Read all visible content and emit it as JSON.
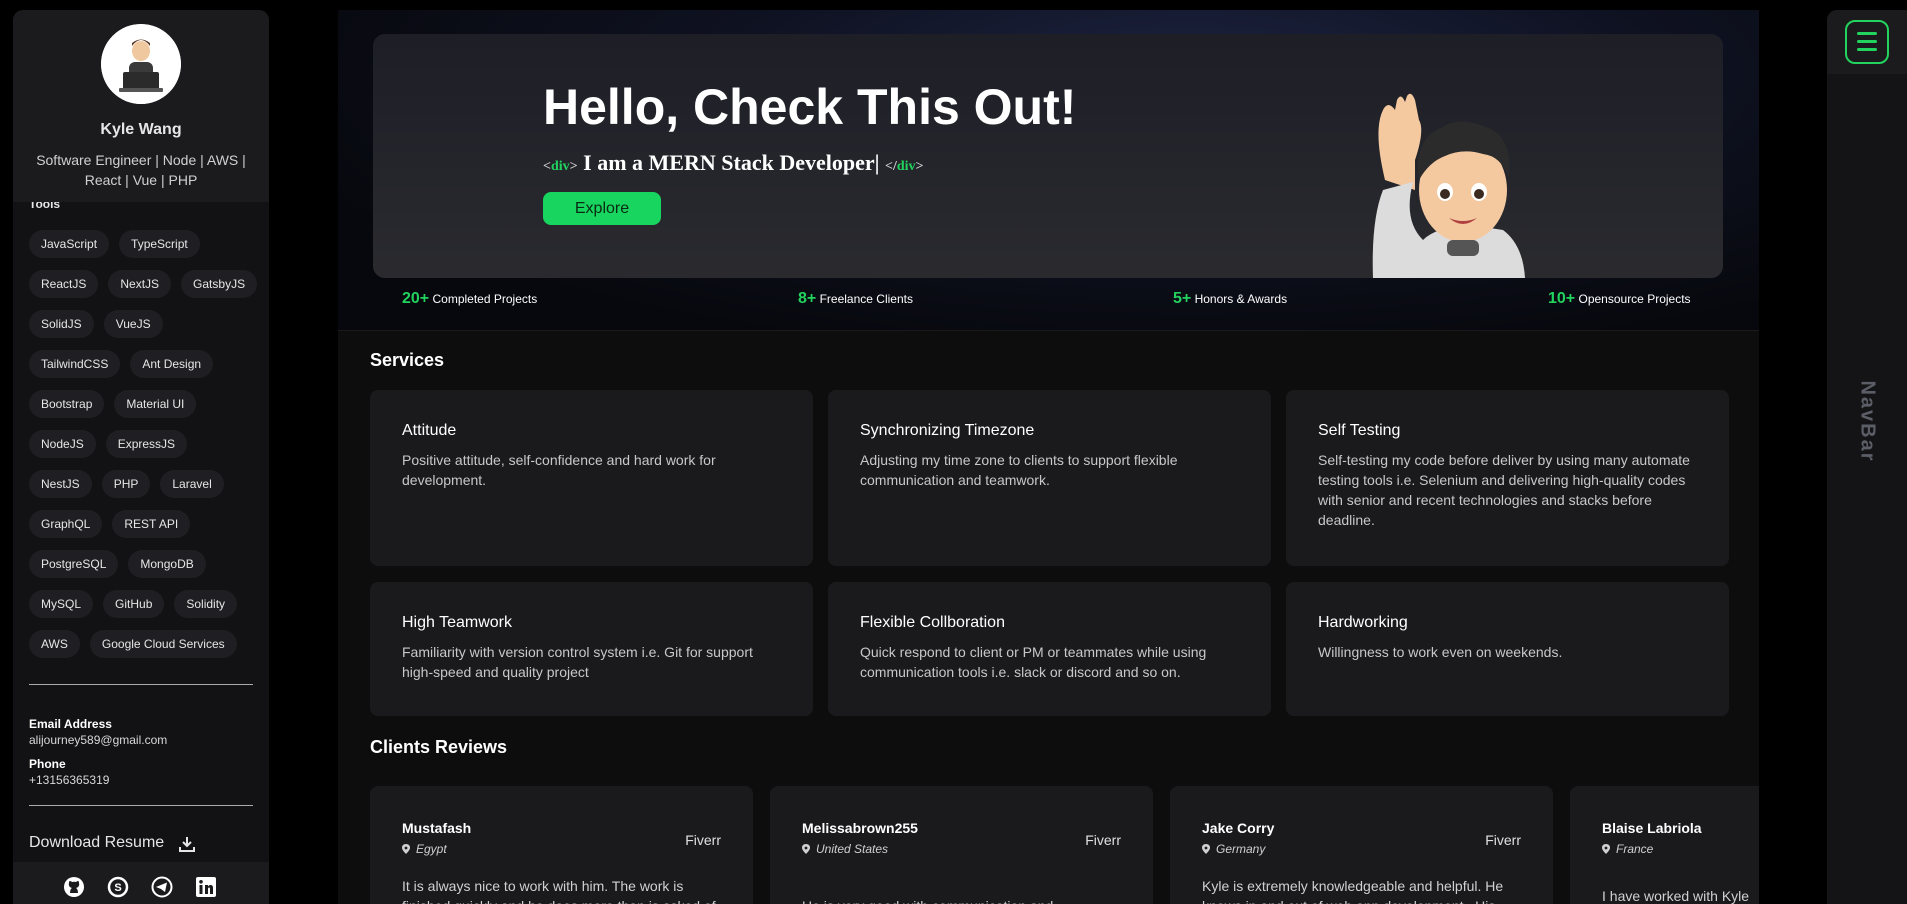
{
  "profile": {
    "name": "Kyle Wang",
    "title": "Software Engineer | Node | AWS | React | Vue | PHP"
  },
  "tools": {
    "label": "Tools",
    "items": [
      "JavaScript",
      "TypeScript",
      "ReactJS",
      "NextJS",
      "GatsbyJS",
      "SolidJS",
      "VueJS",
      "TailwindCSS",
      "Ant Design",
      "Bootstrap",
      "Material UI",
      "NodeJS",
      "ExpressJS",
      "NestJS",
      "PHP",
      "Laravel",
      "GraphQL",
      "REST API",
      "PostgreSQL",
      "MongoDB",
      "MySQL",
      "GitHub",
      "Solidity",
      "AWS",
      "Google Cloud Services"
    ]
  },
  "contact": {
    "email_label": "Email Address",
    "email": "alijourney589@gmail.com",
    "phone_label": "Phone",
    "phone": "+13156365319"
  },
  "resume": {
    "label": "Download Resume",
    "icon": "download-icon"
  },
  "social": [
    "github-icon",
    "skype-icon",
    "telegram-icon",
    "linkedin-icon"
  ],
  "hero": {
    "title": "Hello, Check This Out!",
    "open_tag": "<div>",
    "subtitle": "I am a MERN Stack Developer|",
    "close_tag": "</div>",
    "button": "Explore"
  },
  "stats": [
    {
      "value": "20+",
      "label": "Completed Projects"
    },
    {
      "value": "8+",
      "label": "Freelance Clients"
    },
    {
      "value": "5+",
      "label": "Honors & Awards"
    },
    {
      "value": "10+",
      "label": "Opensource Projects"
    }
  ],
  "services": {
    "title": "Services",
    "items": [
      {
        "title": "Attitude",
        "text": "Positive attitude, self-confidence and hard work for development."
      },
      {
        "title": "Synchronizing Timezone",
        "text": "Adjusting my time zone to clients to support flexible communication and teamwork."
      },
      {
        "title": "Self Testing",
        "text": "Self-testing my code before deliver by using many automate testing tools i.e. Selenium and delivering high-quality codes with senior and recent technologies and stacks before deadline."
      },
      {
        "title": "High Teamwork",
        "text": "Familiarity with version control system i.e. Git for support high-speed and quality project"
      },
      {
        "title": "Flexible Collboration",
        "text": "Quick respond to client or PM or teammates while using communication tools i.e. slack or discord and so on."
      },
      {
        "title": "Hardworking",
        "text": "Willingness to work even on weekends."
      }
    ]
  },
  "reviews": {
    "title": "Clients Reviews",
    "items": [
      {
        "name": "Mustafash",
        "location": "Egypt",
        "source": "Fiverr",
        "text": "It is always nice to work with him. The work is finished quickly and he does more than is asked of"
      },
      {
        "name": "Melissabrown255",
        "location": "United States",
        "source": "Fiverr",
        "text": "He is very good with communication and"
      },
      {
        "name": "Jake Corry",
        "location": "Germany",
        "source": "Fiverr",
        "text": "Kyle is extremely knowledgeable and helpful. He knows in and out of web app development . His"
      },
      {
        "name": "Blaise Labriola",
        "location": "France",
        "source": "",
        "text": "I have worked with Kyle a"
      }
    ]
  },
  "navbar": {
    "label": "NavBar",
    "menu_icon": "menu-icon"
  },
  "colors": {
    "accent": "#22d35e",
    "background": "#000000",
    "card": "#1a1a1c"
  }
}
